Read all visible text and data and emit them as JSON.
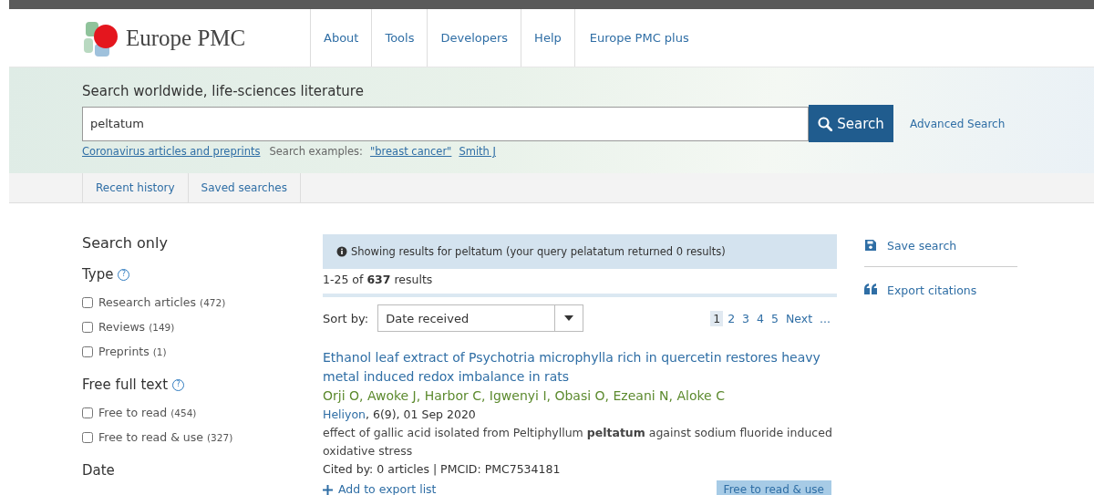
{
  "header": {
    "logo_text": "Europe PMC",
    "nav": [
      "About",
      "Tools",
      "Developers",
      "Help",
      "Europe PMC plus"
    ]
  },
  "search": {
    "heading": "Search worldwide, life-sciences literature",
    "value": "peltatum",
    "button": "Search",
    "advanced": "Advanced Search",
    "covid_link": "Coronavirus articles and preprints",
    "examples_label": "Search examples:",
    "examples": [
      "\"breast cancer\"",
      "Smith J"
    ]
  },
  "history_tabs": [
    {
      "label": "Recent history",
      "selected": false
    },
    {
      "label": "Saved searches",
      "selected": false
    }
  ],
  "filters": {
    "title": "Search only",
    "groups": [
      {
        "title": "Type",
        "help": "?",
        "options": [
          {
            "label": "Research articles",
            "count": "(472)",
            "checked": false
          },
          {
            "label": "Reviews",
            "count": "(149)",
            "checked": false
          },
          {
            "label": "Preprints",
            "count": "(1)",
            "checked": false
          }
        ]
      },
      {
        "title": "Free full text",
        "help": "?",
        "options": [
          {
            "label": "Free to read",
            "count": "(454)",
            "checked": false
          },
          {
            "label": "Free to read & use",
            "count": "(327)",
            "checked": false
          }
        ]
      },
      {
        "title": "Date"
      }
    ]
  },
  "results": {
    "notice": "Showing results for peltatum (your query pelatatum returned 0 results)",
    "summary": "1-25 of **637** results",
    "sort_label": "Sort by:",
    "sort_value": "Date received",
    "pages": [
      {
        "label": "1",
        "selected": true
      },
      {
        "label": "2",
        "selected": false
      },
      {
        "label": "3",
        "selected": false
      },
      {
        "label": "4",
        "selected": false
      },
      {
        "label": "5",
        "selected": false
      },
      {
        "label": "Next",
        "selected": false
      },
      {
        "label": "...",
        "selected": false
      }
    ],
    "items": [
      {
        "title": "Ethanol leaf extract of Psychotria microphylla rich in quercetin restores heavy metal induced redox imbalance in rats",
        "authors": "Orji O, Awoke J, Harbor C, Igwenyi I, Obasi O, Ezeani N, Aloke C",
        "journal": "Heliyon",
        "source_rest": ", 6(9), 01 Sep 2020",
        "snippet": "effect of gallic acid isolated from Peltiphyllum **peltatum** against sodium fluoride induced oxidative stress",
        "meta": "Cited by: 0 articles | PMCID: PMC7534181",
        "add": "Add to export list",
        "badge": "Free to read & use"
      }
    ]
  },
  "actions": [
    "Save search",
    "Export citations"
  ]
}
